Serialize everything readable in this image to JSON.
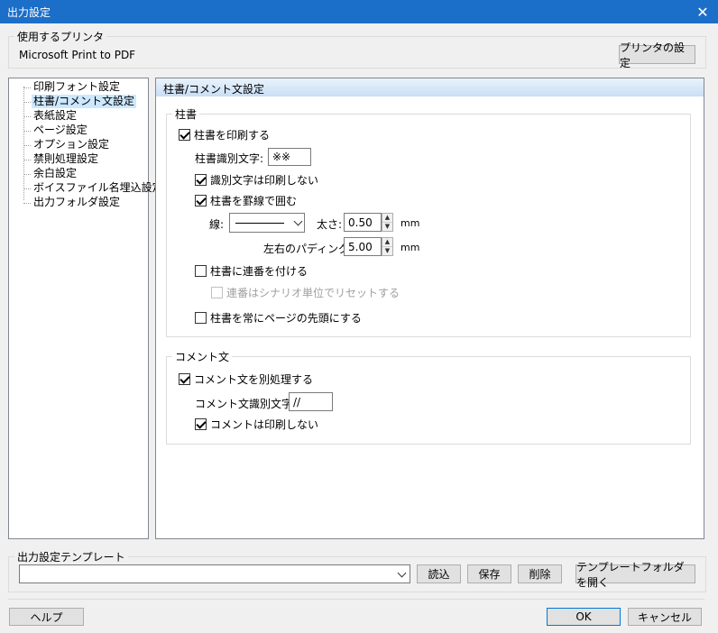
{
  "window": {
    "title": "出力設定",
    "close_glyph": "✕"
  },
  "printer": {
    "group_label": "使用するプリンタ",
    "name": "Microsoft Print to PDF",
    "settings_button": "プリンタの設定"
  },
  "tree": {
    "items": [
      {
        "label": "印刷フォント設定"
      },
      {
        "label": "柱書/コメント文設定"
      },
      {
        "label": "表紙設定"
      },
      {
        "label": "ページ設定"
      },
      {
        "label": "オプション設定"
      },
      {
        "label": "禁則処理設定"
      },
      {
        "label": "余白設定"
      },
      {
        "label": "ボイスファイル名埋込設定"
      },
      {
        "label": "出力フォルダ設定"
      }
    ]
  },
  "panel": {
    "header": "柱書/コメント文設定",
    "hashira": {
      "group_label": "柱書",
      "print_hashira": "柱書を印刷する",
      "identifier_label": "柱書識別文字:",
      "identifier_value": "※※",
      "no_print_identifier": "識別文字は印刷しない",
      "enclose_border": "柱書を罫線で囲む",
      "line_label": "線:",
      "thickness_label": "太さ:",
      "thickness_value": "0.50",
      "thickness_unit": "mm",
      "padding_label": "左右のパディング:",
      "padding_value": "5.00",
      "padding_unit": "mm",
      "add_numbering": "柱書に連番を付ける",
      "reset_numbering": "連番はシナリオ単位でリセットする",
      "always_top": "柱書を常にページの先頭にする"
    },
    "comment": {
      "group_label": "コメント文",
      "process_separately": "コメント文を別処理する",
      "identifier_label": "コメント文識別文字:",
      "identifier_value": "//",
      "no_print": "コメントは印刷しない"
    }
  },
  "template": {
    "group_label": "出力設定テンプレート",
    "selected": "",
    "load": "読込",
    "save": "保存",
    "delete": "削除",
    "open_folder": "テンプレートフォルダを開く"
  },
  "footer": {
    "help": "ヘルプ",
    "ok": "OK",
    "cancel": "キャンセル"
  }
}
